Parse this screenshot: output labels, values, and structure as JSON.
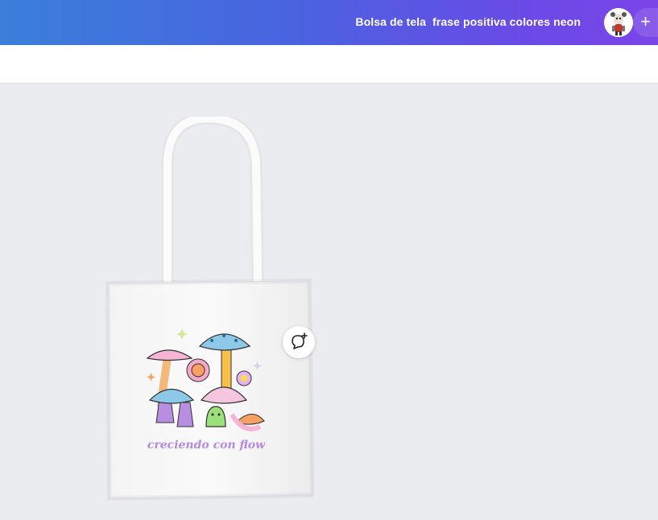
{
  "header": {
    "document_title": "Bolsa de tela  frase positiva colores neon",
    "add_label": "+"
  },
  "design": {
    "tagline": "creciendo con flow"
  },
  "colors": {
    "gradient_start": "#3a7fd9",
    "gradient_end": "#7b45e8",
    "canvas_bg": "#ebecf0",
    "toolbar_bg": "#ffffff"
  },
  "icons": {
    "avatar": "user-avatar-icon",
    "comment": "add-comment-icon",
    "add": "plus-icon"
  }
}
